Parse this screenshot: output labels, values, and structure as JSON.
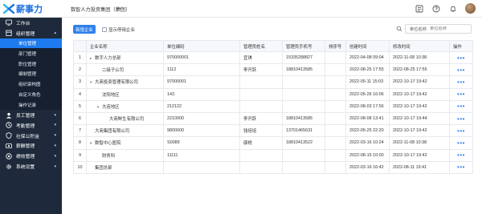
{
  "header": {
    "logo_text": "薪事力",
    "org_name": "数智人力投资集团（集团）"
  },
  "sidebar": {
    "items": [
      {
        "label": "工作台",
        "icon": "workbench-icon"
      },
      {
        "label": "组织管理",
        "icon": "org-icon",
        "expanded": true
      },
      {
        "label": "员工管理",
        "icon": "employee-icon"
      },
      {
        "label": "考勤管理",
        "icon": "attendance-icon"
      },
      {
        "label": "社保公积金",
        "icon": "insurance-icon"
      },
      {
        "label": "薪酬管理",
        "icon": "salary-icon"
      },
      {
        "label": "绩效管理",
        "icon": "performance-icon"
      },
      {
        "label": "系统设置",
        "icon": "settings-icon"
      }
    ],
    "subitems": [
      "单位管理",
      "部门管理",
      "职位管理",
      "编制管理",
      "组织架构图",
      "自定义角色",
      "操作记录"
    ]
  },
  "toolbar": {
    "new_label": "新增企业",
    "show_disabled_label": "显示停用企业",
    "search_label": "单位名称",
    "search_placeholder": "单位名称"
  },
  "table": {
    "columns": [
      "",
      "企业名称",
      "单位编码",
      "管理员姓名",
      "管理员手机号",
      "排序号",
      "创建时间",
      "修改时间",
      "操作"
    ],
    "rows": [
      {
        "idx": "1",
        "name": "数字人力总部",
        "caret": "▸",
        "indent": 0,
        "code": "970000001",
        "admin": "宜琪",
        "phone": "15335288827",
        "sort": "",
        "created": "2022-04-08 09:04",
        "modified": "2022-11-08 10:38",
        "op": "•••"
      },
      {
        "idx": "2",
        "name": "二级子公司",
        "caret": "",
        "indent": 1,
        "code": "1112",
        "admin": "李开跃",
        "phone": "18810413585",
        "sort": "",
        "created": "2022-08-25 17:55",
        "modified": "2022-08-25 17:55",
        "op": "•••"
      },
      {
        "idx": "3",
        "name": "大商投资管理有限公司",
        "caret": "▾",
        "indent": 0,
        "code": "97000001",
        "admin": "",
        "phone": "",
        "sort": "",
        "created": "2022-05-11 15:03",
        "modified": "2022-10-17 19:42",
        "op": "•••"
      },
      {
        "idx": "4",
        "name": "沈阳地区",
        "caret": "",
        "indent": 1,
        "code": "143",
        "admin": "",
        "phone": "",
        "sort": "",
        "created": "2022-05-26 16:06",
        "modified": "2022-10-17 19:42",
        "op": "•••"
      },
      {
        "idx": "5",
        "name": "大连地区",
        "caret": "▾",
        "indent": 1,
        "code": "212122",
        "admin": "",
        "phone": "",
        "sort": "",
        "created": "2022-08-03 17:56",
        "modified": "2022-10-17 19:42",
        "op": "•••"
      },
      {
        "idx": "6",
        "name": "大商鲜生有限公司",
        "caret": "",
        "indent": 2,
        "code": "2210000",
        "admin": "李开跃",
        "phone": "18810413585",
        "sort": "",
        "created": "2022-08-08 13:41",
        "modified": "2022-10-17 19:44",
        "op": "•••"
      },
      {
        "idx": "7",
        "name": "大商集团有限公司",
        "caret": "",
        "indent": 0,
        "code": "9800000",
        "admin": "钱培培",
        "phone": "13701465631",
        "sort": "",
        "created": "2022-05-25 22:20",
        "modified": "2022-10-17 19:42",
        "op": "•••"
      },
      {
        "idx": "8",
        "name": "数智中心医院",
        "caret": "▾",
        "indent": 0,
        "code": "S0089",
        "admin": "康艳",
        "phone": "18810413522",
        "sort": "",
        "created": "2022-03-16 10:24",
        "modified": "2022-11-08 10:38",
        "op": "•••"
      },
      {
        "idx": "9",
        "name": "财务科",
        "caret": "",
        "indent": 1,
        "code": "11111",
        "admin": "",
        "phone": "",
        "sort": "",
        "created": "2022-08-15 10:00",
        "modified": "2022-10-17 19:42",
        "op": "•••"
      },
      {
        "idx": "10",
        "name": "集团总部",
        "caret": "",
        "indent": 0,
        "code": "",
        "admin": "",
        "phone": "",
        "sort": "",
        "created": "2022-03-16 16:42",
        "modified": "2022-08-11 19:41",
        "op": "•••"
      }
    ]
  },
  "colors": {
    "accent": "#2f80ed",
    "sidebar_bg": "#1e2a3b",
    "sidebar_active": "#1d7aef"
  }
}
